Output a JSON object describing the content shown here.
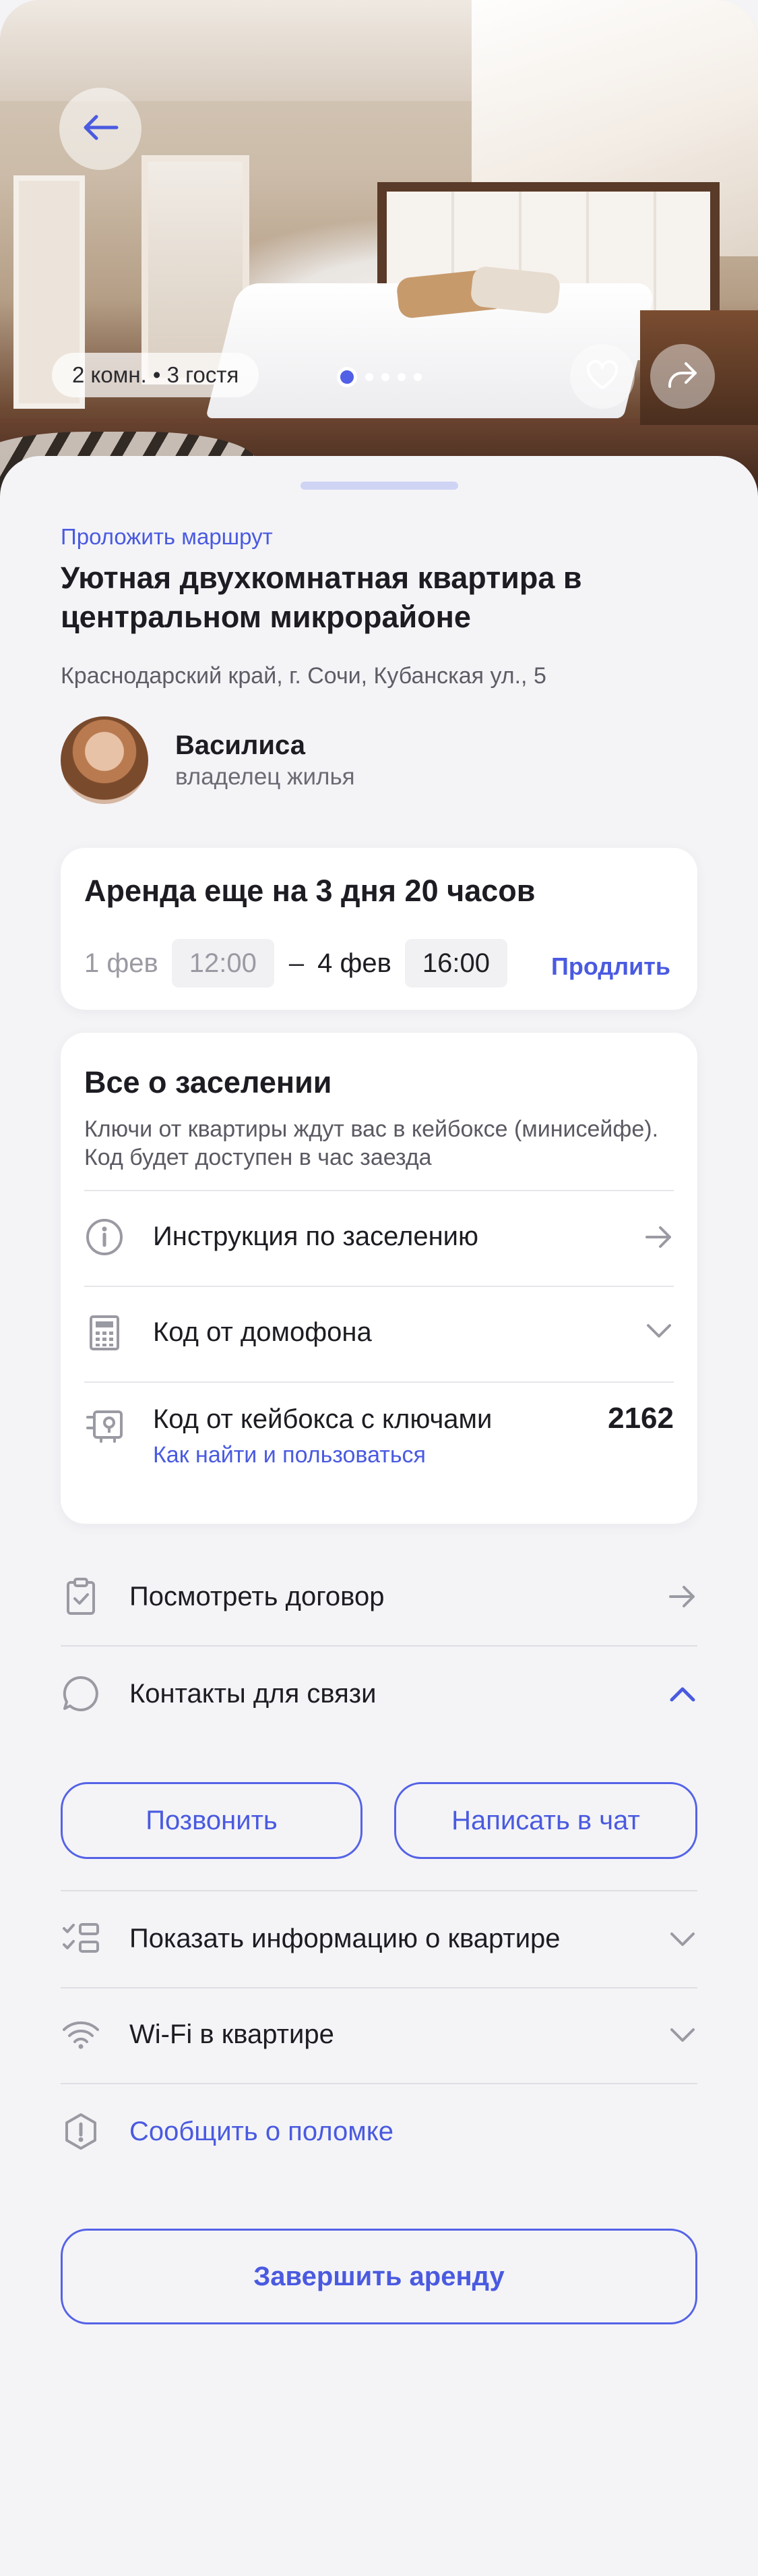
{
  "hero": {
    "chip_label": "2 комн. • 3 гостя",
    "carousel": {
      "total": 5,
      "active_index": 1
    },
    "icons": {
      "back": "arrow-left-icon",
      "favorite": "heart-icon",
      "share": "share-icon"
    }
  },
  "listing": {
    "route_link": "Проложить маршрут",
    "title": "Уютная двухкомнатная квартира в центральном микрорайоне",
    "address": "Краснодарский край, г. Сочи, Кубанская ул., 5"
  },
  "host": {
    "name": "Василиса",
    "role": "владелец жилья"
  },
  "rental": {
    "title": "Аренда еще на 3 дня 20 часов",
    "start_date": "1 фев",
    "start_time": "12:00",
    "separator": "–",
    "end_date": "4 фев",
    "end_time": "16:00",
    "extend_label": "Продлить"
  },
  "checkin": {
    "title": "Все о заселении",
    "description": "Ключи от квартиры ждут вас в кейбоксе (минисейфе). Код будет доступен в час заезда",
    "rows": [
      {
        "label": "Инструкция по заселению",
        "icon": "info-icon",
        "end_icon": "arrow-right-icon"
      },
      {
        "label": "Код от домофона",
        "icon": "intercom-icon",
        "end_icon": "chevron-down-icon"
      },
      {
        "label": "Код от кейбокса с ключами",
        "icon": "keybox-icon",
        "value": "2162",
        "sub_link": "Как найти и пользоваться"
      }
    ]
  },
  "actions": {
    "contract": "Посмотреть договор",
    "contacts": "Контакты для связи",
    "call_button": "Позвонить",
    "chat_button": "Написать в чат",
    "apartment_info": "Показать информацию о квартире",
    "wifi": "Wi-Fi в квартире",
    "report_issue": "Сообщить о поломке",
    "finish_rent": "Завершить аренду"
  },
  "colors": {
    "accent": "#4a5ae0",
    "background": "#f4f4f7",
    "card": "#ffffff",
    "text_primary": "#1c1c22",
    "text_secondary": "#5d5d66"
  }
}
